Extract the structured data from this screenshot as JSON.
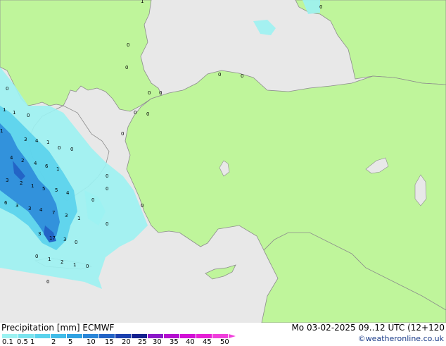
{
  "footer": {
    "title_left": "Precipitation [mm]  ECMWF",
    "title_right": "Mo 03-02-2025 09..12 UTC (12+120",
    "credit": "©weatheronline.co.uk"
  },
  "legend": {
    "ticks": [
      "0.1",
      "0.5",
      "1",
      "2",
      "5",
      "10",
      "15",
      "20",
      "25",
      "30",
      "35",
      "40",
      "45",
      "50"
    ],
    "colors": [
      "#9cf2f2",
      "#7ae4ef",
      "#5ad2ec",
      "#42bce8",
      "#30a2e2",
      "#2a86d8",
      "#2364c6",
      "#1b40ae",
      "#13208f",
      "#8a18c8",
      "#b410d0",
      "#d210d6",
      "#e620d6",
      "#f040dc"
    ]
  },
  "map": {
    "land_color": "#bff59b",
    "sea_color": "#e8e8e8",
    "border_color": "#8c8c8c",
    "cell_values": [
      "0",
      "1",
      "0",
      "0",
      "0",
      "0",
      "0",
      "0",
      "0",
      "0",
      "1",
      "1",
      "0",
      "1",
      "3",
      "4",
      "1",
      "0",
      "4",
      "2",
      "4",
      "6",
      "1",
      "3",
      "2",
      "1",
      "5",
      "5",
      "4",
      "6",
      "3",
      "3",
      "4",
      "7",
      "3",
      "1",
      "3",
      "17",
      "3",
      "0",
      "0",
      "1",
      "2",
      "1",
      "0",
      "0",
      "0",
      "0",
      "0",
      "0",
      "0",
      "0",
      "0",
      "0"
    ]
  }
}
